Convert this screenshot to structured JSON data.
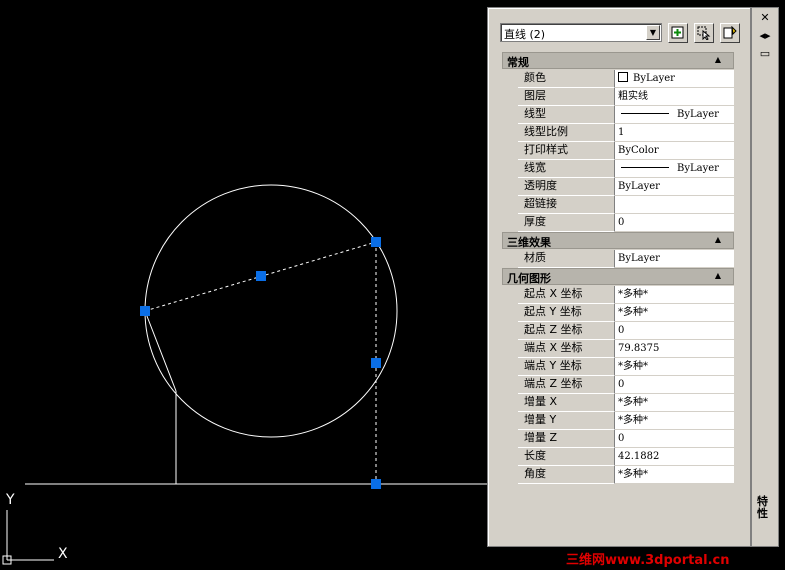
{
  "palette": {
    "object_selector": "直线 (2)",
    "side_title": "特性",
    "side_buttons": [
      "✕",
      "◂▸",
      "▭"
    ]
  },
  "categories": [
    {
      "title": "常规",
      "rows": [
        {
          "label": "颜色",
          "value": "ByLayer",
          "kind": "swatch"
        },
        {
          "label": "图层",
          "value": "粗实线"
        },
        {
          "label": "线型",
          "value": "ByLayer",
          "kind": "line"
        },
        {
          "label": "线型比例",
          "value": "1"
        },
        {
          "label": "打印样式",
          "value": "ByColor"
        },
        {
          "label": "线宽",
          "value": "ByLayer",
          "kind": "line"
        },
        {
          "label": "透明度",
          "value": "ByLayer"
        },
        {
          "label": "超链接",
          "value": ""
        },
        {
          "label": "厚度",
          "value": "0"
        }
      ]
    },
    {
      "title": "三维效果",
      "rows": [
        {
          "label": "材质",
          "value": "ByLayer"
        }
      ]
    },
    {
      "title": "几何图形",
      "rows": [
        {
          "label": "起点 X 坐标",
          "value": "*多种*"
        },
        {
          "label": "起点 Y 坐标",
          "value": "*多种*"
        },
        {
          "label": "起点 Z 坐标",
          "value": "0"
        },
        {
          "label": "端点 X 坐标",
          "value": "79.8375"
        },
        {
          "label": "端点 Y 坐标",
          "value": "*多种*"
        },
        {
          "label": "端点 Z 坐标",
          "value": "0"
        },
        {
          "label": "增量 X",
          "value": "*多种*"
        },
        {
          "label": "增量 Y",
          "value": "*多种*"
        },
        {
          "label": "增量 Z",
          "value": "0"
        },
        {
          "label": "长度",
          "value": "42.1882"
        },
        {
          "label": "角度",
          "value": "*多种*"
        }
      ]
    }
  ],
  "ucs": {
    "y_label": "Y",
    "x_label": "X"
  },
  "watermark": "三维网www.3dportal.cn",
  "colors": {
    "canvas": "#000000",
    "grip": "#0a6ee6",
    "panel": "#d4d0c8",
    "watermark": "#e00000"
  }
}
